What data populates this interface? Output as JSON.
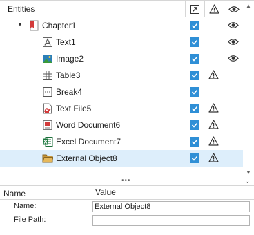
{
  "header": {
    "title": "Entities",
    "col_link_icon": "link-out-icon",
    "col_warn_icon": "warning-icon",
    "col_eye_icon": "eye-icon"
  },
  "tree": {
    "root": {
      "label": "Chapter1",
      "icon": "chapter-bookmark-icon",
      "expanded": true
    },
    "items": [
      {
        "label": "Text1",
        "icon": "text-icon",
        "checked": true,
        "warning": false,
        "visible_eye": true
      },
      {
        "label": "Image2",
        "icon": "image-icon",
        "checked": true,
        "warning": false,
        "visible_eye": true
      },
      {
        "label": "Table3",
        "icon": "table-icon",
        "checked": true,
        "warning": true,
        "visible_eye": false
      },
      {
        "label": "Break4",
        "icon": "break-icon",
        "checked": true,
        "warning": false,
        "visible_eye": false
      },
      {
        "label": "Text File5",
        "icon": "pdf-file-icon",
        "checked": true,
        "warning": true,
        "visible_eye": false
      },
      {
        "label": "Word Document6",
        "icon": "word-doc-icon",
        "checked": true,
        "warning": true,
        "visible_eye": false
      },
      {
        "label": "Excel Document7",
        "icon": "excel-doc-icon",
        "checked": true,
        "warning": true,
        "visible_eye": false
      },
      {
        "label": "External Object8",
        "icon": "folder-icon",
        "checked": true,
        "warning": true,
        "visible_eye": false,
        "selected": true
      }
    ]
  },
  "properties": {
    "col_name": "Name",
    "col_value": "Value",
    "rows": [
      {
        "label": "Name:",
        "value": "External Object8"
      },
      {
        "label": "File Path:",
        "value": ""
      }
    ]
  },
  "colors": {
    "accent": "#2f8fd6",
    "selection": "#ddeefb",
    "border": "#d6d6d6"
  }
}
